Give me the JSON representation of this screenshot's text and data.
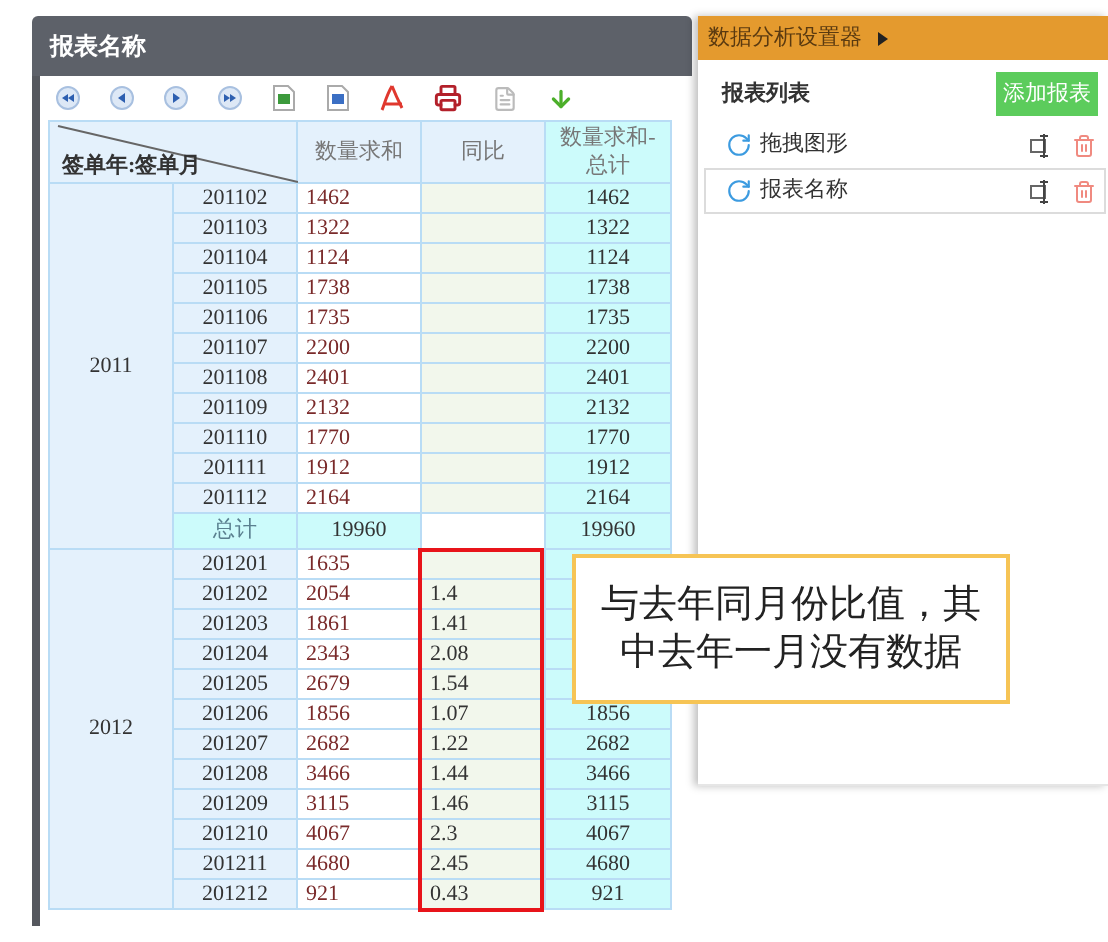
{
  "report": {
    "title": "报表名称",
    "corner": "签单年:签单月",
    "columns": [
      "数量求和",
      "同比",
      "数量求和-总计"
    ],
    "groups": [
      {
        "year": "2011",
        "highlighted": false,
        "rows": [
          {
            "month": "201102",
            "sum": "1462",
            "total": "1462"
          },
          {
            "month": "201103",
            "sum": "1322",
            "total": "1322"
          },
          {
            "month": "201104",
            "sum": "1124",
            "total": "1124"
          },
          {
            "month": "201105",
            "sum": "1738",
            "total": "1738"
          },
          {
            "month": "201106",
            "sum": "1735",
            "total": "1735"
          },
          {
            "month": "201107",
            "sum": "2200",
            "total": "2200"
          },
          {
            "month": "201108",
            "sum": "2401",
            "total": "2401"
          },
          {
            "month": "201109",
            "sum": "2132",
            "total": "2132"
          },
          {
            "month": "201110",
            "sum": "1770",
            "total": "1770"
          },
          {
            "month": "201111",
            "sum": "1912",
            "total": "1912"
          },
          {
            "month": "201112",
            "sum": "2164",
            "total": "2164"
          }
        ],
        "subtotal": {
          "label": "总计",
          "sum": "19960",
          "total": "19960"
        }
      },
      {
        "year": "2012",
        "highlighted": true,
        "rows": [
          {
            "month": "201201",
            "sum": "1635"
          },
          {
            "month": "201202",
            "sum": "2054",
            "ratio": "1.4"
          },
          {
            "month": "201203",
            "sum": "1861",
            "ratio": "1.41"
          },
          {
            "month": "201204",
            "sum": "2343",
            "ratio": "2.08"
          },
          {
            "month": "201205",
            "sum": "2679",
            "ratio": "1.54"
          },
          {
            "month": "201206",
            "sum": "1856",
            "ratio": "1.07",
            "total": "1856"
          },
          {
            "month": "201207",
            "sum": "2682",
            "ratio": "1.22",
            "total": "2682"
          },
          {
            "month": "201208",
            "sum": "3466",
            "ratio": "1.44",
            "total": "3466"
          },
          {
            "month": "201209",
            "sum": "3115",
            "ratio": "1.46",
            "total": "3115"
          },
          {
            "month": "201210",
            "sum": "4067",
            "ratio": "2.3",
            "total": "4067"
          },
          {
            "month": "201211",
            "sum": "4680",
            "ratio": "2.45",
            "total": "4680"
          },
          {
            "month": "201212",
            "sum": "921",
            "ratio": "0.43",
            "total": "921"
          }
        ]
      }
    ]
  },
  "panel": {
    "title": "数据分析设置器",
    "list_title": "报表列表",
    "add_button": "添加报表",
    "items": [
      {
        "label": "拖拽图形",
        "selected": false
      },
      {
        "label": "报表名称",
        "selected": true
      }
    ]
  },
  "callout": {
    "text": "与去年同月份比值，其中去年一月没有数据"
  }
}
